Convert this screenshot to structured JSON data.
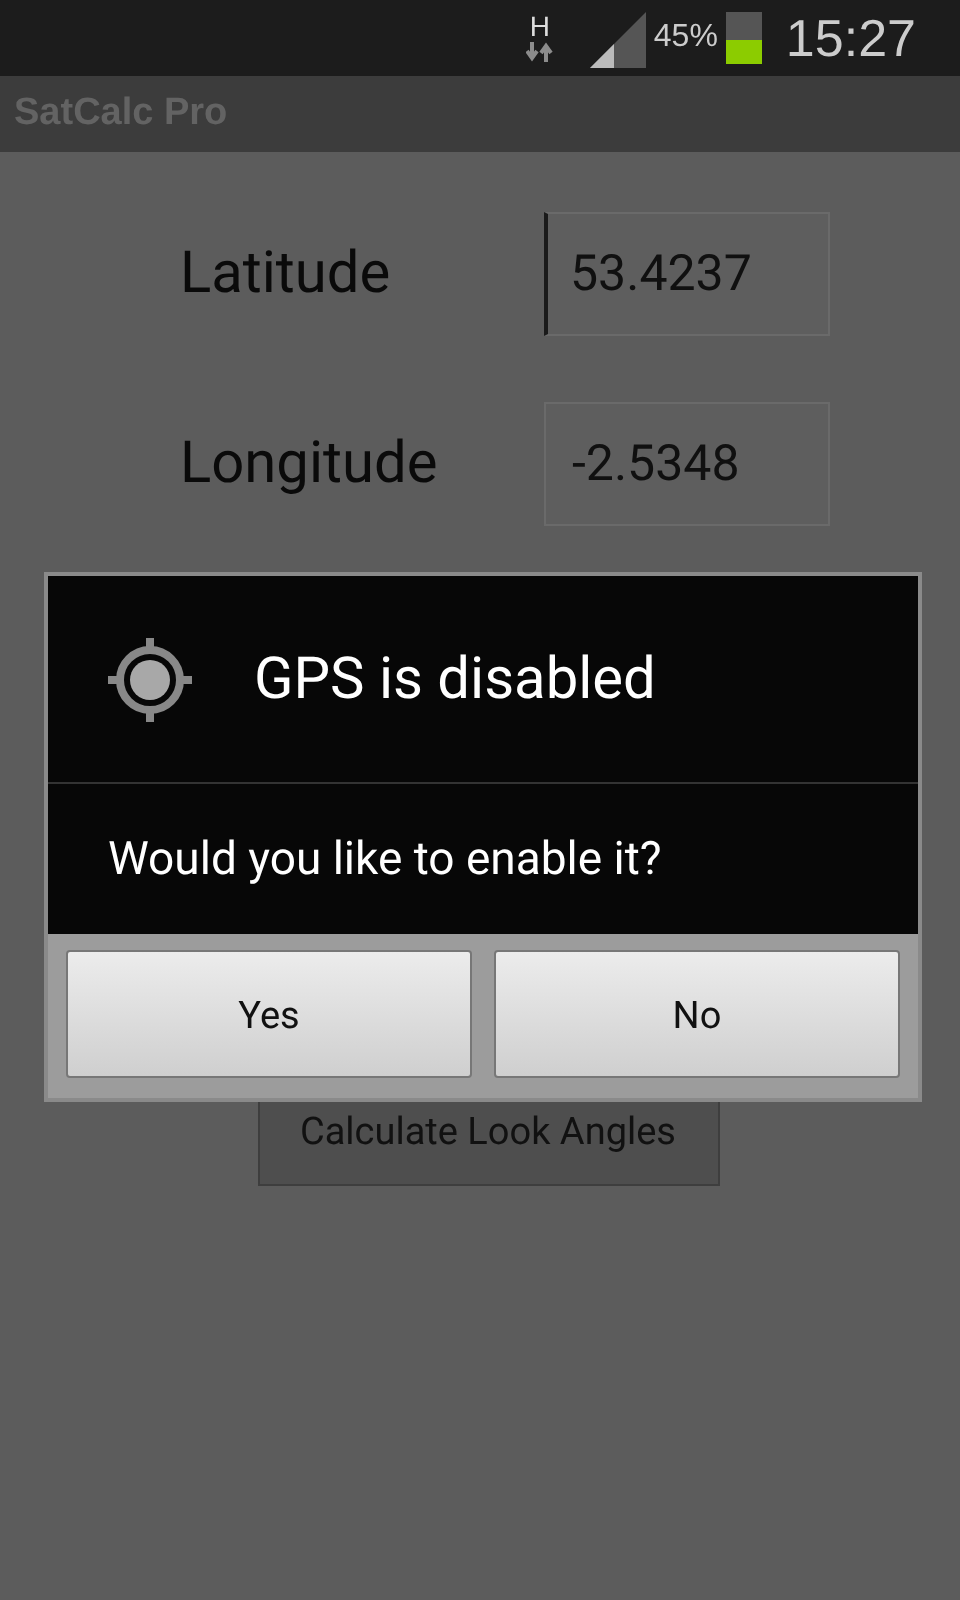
{
  "status_bar": {
    "network": "H",
    "battery_percent": "45%",
    "time": "15:27"
  },
  "app_bar": {
    "title": "SatCalc Pro"
  },
  "form": {
    "fields": [
      {
        "label": "Latitude",
        "value": "53.4237",
        "focused": true
      },
      {
        "label": "Longitude",
        "value": "-2.5348",
        "focused": false
      }
    ],
    "button": "Calculate Look Angles"
  },
  "dialog": {
    "title": "GPS is disabled",
    "message": "Would you like to enable it?",
    "buttons": [
      "Yes",
      "No"
    ]
  }
}
